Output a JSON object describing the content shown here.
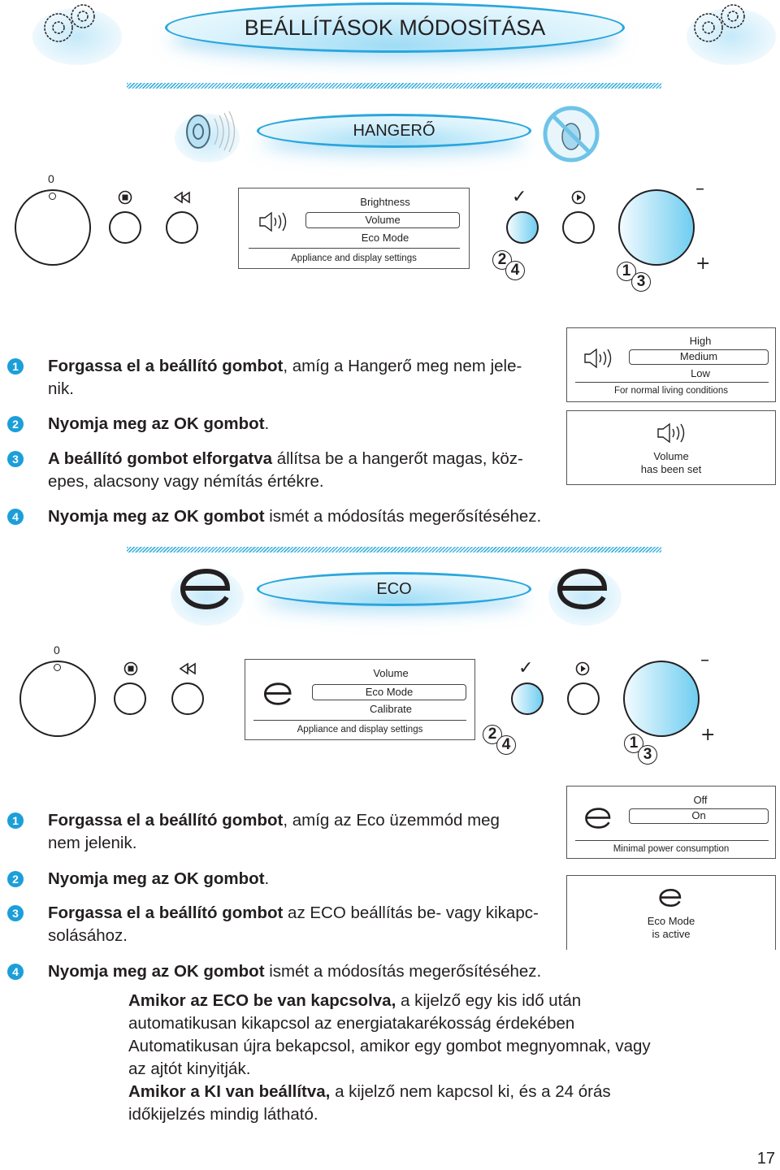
{
  "page": {
    "title": "BEÁLLÍTÁSOK MÓDOSÍTÁSA",
    "page_number": "17",
    "icons": {
      "left": "gears-icon",
      "right": "gears-icon"
    }
  },
  "volume_section": {
    "heading": "HANGERŐ",
    "icons": {
      "left": "speaker-icon",
      "right": "speaker-muted-icon"
    },
    "control_panel": {
      "dial_zero_label": "0",
      "stop_symbol": "⏹",
      "back_symbol": "⏪",
      "ok_symbol": "✓",
      "play_symbol": "▶",
      "minus_label": "–",
      "plus_label": "+",
      "ok_steps": [
        "2",
        "4"
      ],
      "knob_steps": [
        "1",
        "3"
      ],
      "display": {
        "options": [
          "Brightness",
          "Volume",
          "Eco Mode"
        ],
        "selected": "Volume",
        "footer": "Appliance and display settings"
      }
    },
    "screen_level": {
      "options": [
        "High",
        "Medium",
        "Low"
      ],
      "selected": "Medium",
      "footer": "For normal living conditions"
    },
    "screen_confirm": {
      "line1": "Volume",
      "line2": "has been set"
    },
    "steps": [
      {
        "num": "1",
        "bold": "Forgassa el a beállító gombot",
        "rest": ", amíg a Hangerő meg nem jele-",
        "line2": "nik."
      },
      {
        "num": "2",
        "bold": "Nyomja meg az OK gombot",
        "rest": ".",
        "line2": ""
      },
      {
        "num": "3",
        "bold": "A beállító gombot elforgatva",
        "rest": " állítsa be a hangerőt magas, köz-",
        "line2": "epes, alacsony vagy némítás értékre."
      },
      {
        "num": "4",
        "bold": "Nyomja meg az OK gombot",
        "rest": " ismét a módosítás megerősítéséhez.",
        "line2": ""
      }
    ]
  },
  "eco_section": {
    "heading": "ECO",
    "icons": {
      "left": "eco-e-icon",
      "right": "eco-e-icon"
    },
    "control_panel": {
      "dial_zero_label": "0",
      "minus_label": "–",
      "plus_label": "+",
      "ok_steps": [
        "2",
        "4"
      ],
      "knob_steps": [
        "1",
        "3"
      ],
      "display": {
        "options": [
          "Volume",
          "Eco Mode",
          "Calibrate"
        ],
        "selected": "Eco Mode",
        "footer": "Appliance and display settings"
      }
    },
    "screen_toggle": {
      "options": [
        "Off",
        "On"
      ],
      "selected": "On",
      "footer": "Minimal power consumption"
    },
    "screen_confirm": {
      "line1": "Eco Mode",
      "line2": "is active"
    },
    "steps": [
      {
        "num": "1",
        "bold": "Forgassa el a beállító gombot",
        "rest": ", amíg az Eco üzemmód meg",
        "line2": "nem jelenik."
      },
      {
        "num": "2",
        "bold": "Nyomja meg az OK gombot",
        "rest": ".",
        "line2": ""
      },
      {
        "num": "3",
        "bold": "Forgassa el a beállító gombot",
        "rest": " az ECO beállítás be- vagy kikapc-",
        "line2": "solásához."
      },
      {
        "num": "4",
        "bold": "Nyomja meg az OK gombot",
        "rest": " ismét a módosítás megerősítéséhez.",
        "line2": ""
      }
    ],
    "notes": [
      {
        "bold": "Amikor az ECO be van kapcsolva,",
        "rest": " a kijelző egy kis idő után automatikusan kikapcsol az energiatakarékosság érdekében Automatikusan újra bekapcsol, amikor egy gombot megnyomnak, vagy az ajtót kinyitják."
      },
      {
        "bold": "Amikor a KI van beállítva,",
        "rest": " a kijelző nem kapcsol ki, és a 24 órás időkijelzés mindig látható."
      }
    ]
  }
}
